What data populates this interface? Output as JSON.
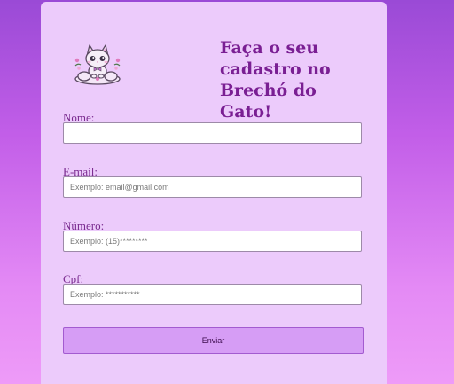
{
  "form": {
    "title": "Faça o seu cadastro no Brechó do Gato!",
    "logo_icon": "cat-mascot-icon",
    "fields": [
      {
        "label": "Nome:",
        "value": "",
        "placeholder": ""
      },
      {
        "label": "E-mail:",
        "value": "",
        "placeholder": "Exemplo: email@gmail.com"
      },
      {
        "label": "Número:",
        "value": "",
        "placeholder": "Exemplo: (15)*********"
      },
      {
        "label": "Cpf:",
        "value": "",
        "placeholder": "Exemplo: ***********"
      }
    ],
    "submit_label": "Enviar"
  },
  "colors": {
    "background_top": "#9a4ad6",
    "background_bottom": "#ee9bf8",
    "card": "#eccbfb",
    "heading": "#7a1f93",
    "button": "#d69df5",
    "button_border": "#a35bd0"
  }
}
